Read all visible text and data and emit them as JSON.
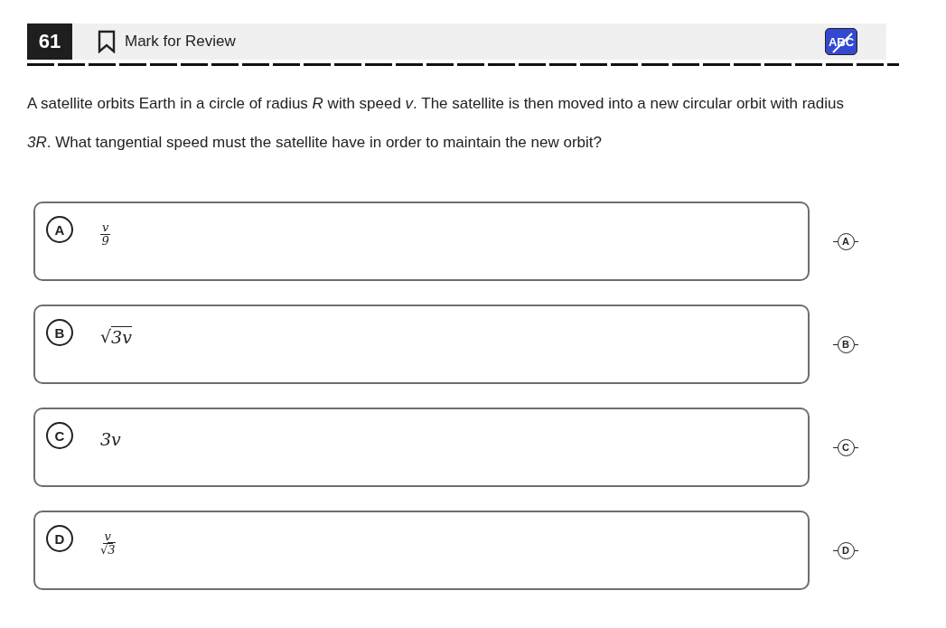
{
  "header": {
    "number": "61",
    "mark_for_review": {
      "label": "Mark for Review",
      "checked": false
    },
    "abc_button": {
      "label": "ABC",
      "on": true
    }
  },
  "question": "A satellite orbits Earth in a circle of radius *R* with speed *v*. The satellite is then moved into a new circular orbit with radius *3R*. What tangential speed must the satellite have in order to maintain the new orbit?",
  "choices": [
    {
      "letter": "A",
      "kind": "fraction",
      "numerator": "v",
      "denominator": "9",
      "crossed_out": false
    },
    {
      "letter": "B",
      "kind": "root",
      "radical": "√",
      "body": "3v",
      "crossed_out": false
    },
    {
      "letter": "C",
      "kind": "plain",
      "body": "3v",
      "crossed_out": false
    },
    {
      "letter": "D",
      "kind": "fraction",
      "numerator": "v",
      "denominator_radical": "√",
      "denominator": "3",
      "crossed_out": false
    }
  ],
  "strike_buttons": [
    "A",
    "B",
    "C",
    "D"
  ]
}
